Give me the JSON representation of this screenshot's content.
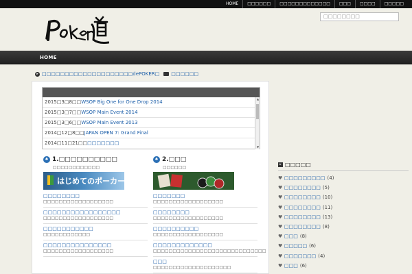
{
  "top_nav": [
    "HOME",
    "□□□□□□",
    "□□□□□□□□□□□□□",
    "□□□",
    "□□□□",
    "□□□□□"
  ],
  "search": {
    "placeholder": "□□□□□□□□"
  },
  "nav": {
    "home": "HOME"
  },
  "breadcrumb": {
    "link": "□□□□□□□□□□□□□□□□□□□□dePOKER□",
    "gallery": "□□□□□□"
  },
  "news": [
    {
      "date": "2015□3□8□□",
      "title": "WSOP Big One for One Drop 2014"
    },
    {
      "date": "2015□3□7□□",
      "title": "WSOP Main Event 2014"
    },
    {
      "date": "2015□3□6□□",
      "title": "WSOP Main Event 2013"
    },
    {
      "date": "2014□12□8□□",
      "title": "JAPAN OPEN 7: Grand Final"
    },
    {
      "date": "2014□11□21□□",
      "title": "□□□□□□□"
    }
  ],
  "columns": [
    {
      "title": "1.□□□□□□□□□□",
      "subtitle": "□□□□□□□□□□□□",
      "banner_text": "はじめてのポーカー",
      "items": [
        {
          "title": "□□□□□□□□",
          "desc": "□□□□□□□□□□□□□□□□□□"
        },
        {
          "title": "□□□□□□□□□□□□□□□□□",
          "desc": "□□□□□□□□□□□□□□□□□□"
        },
        {
          "title": "□□□□□□□□□□□",
          "desc": "□□□□□□□□□□□□"
        },
        {
          "title": "□□□□□□□□□□□□□□□",
          "desc": "□□□□□□□□□□□□□□□□□□"
        }
      ]
    },
    {
      "title": "2.□□□",
      "subtitle": "□□□□□□",
      "banner_text": "",
      "items": [
        {
          "title": "□□□□□□□",
          "desc": "□□□□□□□□□□□□□□□□□□"
        },
        {
          "title": "□□□□□□□□",
          "desc": "□□□□□□□□□□□□□□□□□□"
        },
        {
          "title": "□□□□□□□□□□",
          "desc": "□□□□□□□□□□□□□□□□□□"
        },
        {
          "title": "□□□□□□□□□□□□□",
          "desc": "□□□□□□□□□□□□□□□□□□□□□□□□□□□□□"
        },
        {
          "title": "□□□",
          "desc": "□□□□□□□□□□□□□□□□□□□□"
        }
      ]
    }
  ],
  "sidebar": {
    "heading": "□□□□□",
    "categories": [
      {
        "name": "□□□□□□□□□",
        "count": "(4)"
      },
      {
        "name": "□□□□□□□□",
        "count": "(5)"
      },
      {
        "name": "□□□□□□□□",
        "count": "(10)"
      },
      {
        "name": "□□□□□□□□",
        "count": "(11)"
      },
      {
        "name": "□□□□□□□□",
        "count": "(13)"
      },
      {
        "name": "□□□□□□□□",
        "count": "(8)"
      },
      {
        "name": "□□□",
        "count": "(8)"
      },
      {
        "name": "□□□□□",
        "count": "(6)"
      },
      {
        "name": "□□□□□□□",
        "count": "(4)"
      },
      {
        "name": "□□□",
        "count": "(6)"
      }
    ]
  }
}
